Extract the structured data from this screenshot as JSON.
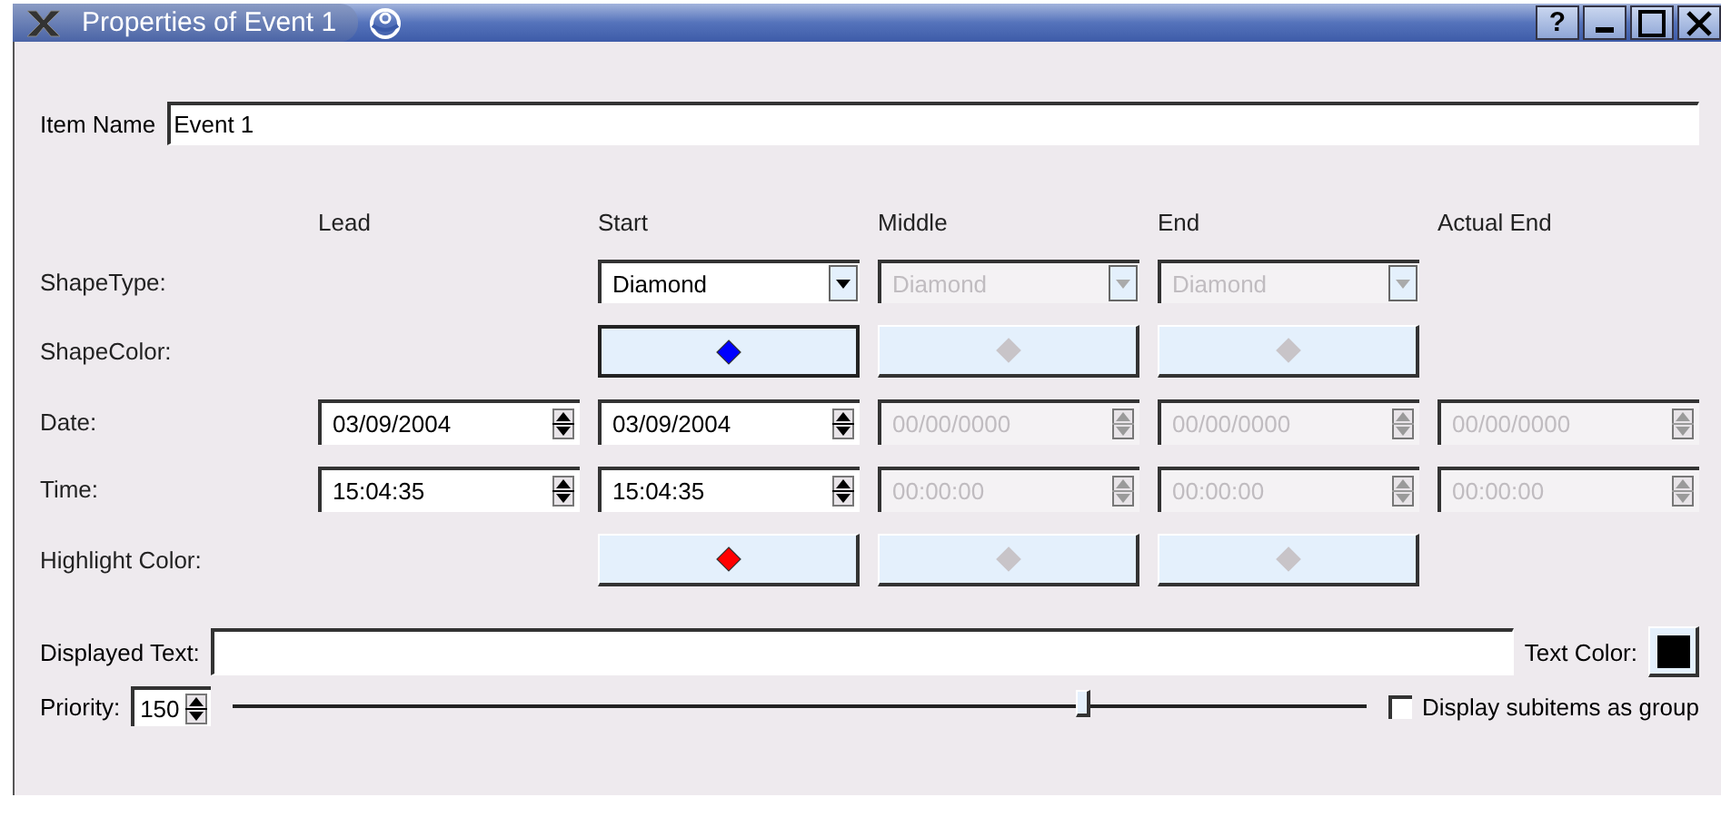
{
  "window": {
    "title": "Properties of Event 1",
    "help_button": "?"
  },
  "item_name": {
    "label": "Item Name",
    "value": "Event 1"
  },
  "columns": [
    "Lead",
    "Start",
    "Middle",
    "End",
    "Actual End"
  ],
  "rows": [
    {
      "label": "ShapeType:",
      "cells": [
        {
          "kind": "blank"
        },
        {
          "kind": "combo",
          "value": "Diamond",
          "disabled": false
        },
        {
          "kind": "combo",
          "value": "Diamond",
          "disabled": true
        },
        {
          "kind": "combo",
          "value": "Diamond",
          "disabled": true
        },
        {
          "kind": "blank"
        }
      ]
    },
    {
      "label": "ShapeColor:",
      "cells": [
        {
          "kind": "blank"
        },
        {
          "kind": "color",
          "color": "#0000ff",
          "disabled": false,
          "focused": true
        },
        {
          "kind": "color",
          "color": "#c8c4c8",
          "disabled": true,
          "focused": false
        },
        {
          "kind": "color",
          "color": "#c8c4c8",
          "disabled": true,
          "focused": false
        },
        {
          "kind": "blank"
        }
      ]
    },
    {
      "label": "Date:",
      "cells": [
        {
          "kind": "spin",
          "value": "03/09/2004",
          "disabled": false
        },
        {
          "kind": "spin",
          "value": "03/09/2004",
          "disabled": false
        },
        {
          "kind": "spin",
          "value": "00/00/0000",
          "disabled": true
        },
        {
          "kind": "spin",
          "value": "00/00/0000",
          "disabled": true
        },
        {
          "kind": "spin",
          "value": "00/00/0000",
          "disabled": true
        }
      ]
    },
    {
      "label": "Time:",
      "cells": [
        {
          "kind": "spin",
          "value": "15:04:35",
          "disabled": false
        },
        {
          "kind": "spin",
          "value": "15:04:35",
          "disabled": false
        },
        {
          "kind": "spin",
          "value": "00:00:00",
          "disabled": true
        },
        {
          "kind": "spin",
          "value": "00:00:00",
          "disabled": true
        },
        {
          "kind": "spin",
          "value": "00:00:00",
          "disabled": true
        }
      ]
    },
    {
      "label": "Highlight Color:",
      "cells": [
        {
          "kind": "blank"
        },
        {
          "kind": "color",
          "color": "#ff0000",
          "disabled": false,
          "focused": false
        },
        {
          "kind": "color",
          "color": "#c8c4c8",
          "disabled": true,
          "focused": false
        },
        {
          "kind": "color",
          "color": "#c8c4c8",
          "disabled": true,
          "focused": false
        },
        {
          "kind": "blank"
        }
      ]
    }
  ],
  "displayed_text": {
    "label": "Displayed Text:"
  },
  "text_color": {
    "label": "Text Color:",
    "color": "#000000"
  },
  "priority": {
    "label": "Priority:",
    "value": "150",
    "level": 0.75
  },
  "group_option": {
    "label": "Display subitems as group",
    "checked": false
  }
}
